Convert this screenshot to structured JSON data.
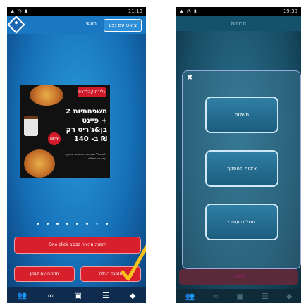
{
  "left": {
    "status_time": "11:13",
    "status_icons": "▲ ◔ ▮",
    "chat_button": "צ'אט עם נציג",
    "home_label": "ראשי",
    "banner": {
      "title": "גלידת קבלדרס",
      "headline": "2 משפחתיות + פיינט בן&ג'ריס רק ב- 140 ₪",
      "small_text": "לא כולל תוספות משלוחים. בתוקף עד גמר המלאי"
    },
    "buttons": {
      "fast_order": "One click pizza הזמנה מהירה",
      "coupon_order": "הזמנה עם קופון",
      "regular_order": "הזמנה רגילה"
    },
    "nav_icons": [
      "people-icon",
      "ooo-icon",
      "gift-icon",
      "menu-icon",
      "logo-icon"
    ]
  },
  "right": {
    "status_time": "19:38",
    "status_icons": "▲ ◔ ▮",
    "top_title": "ארוחות",
    "options": {
      "delivery": "משלוח",
      "pickup": "איסוף מהסניף",
      "future_delivery": "משלוח עתידי"
    },
    "bottom_button": "להמשיך"
  }
}
